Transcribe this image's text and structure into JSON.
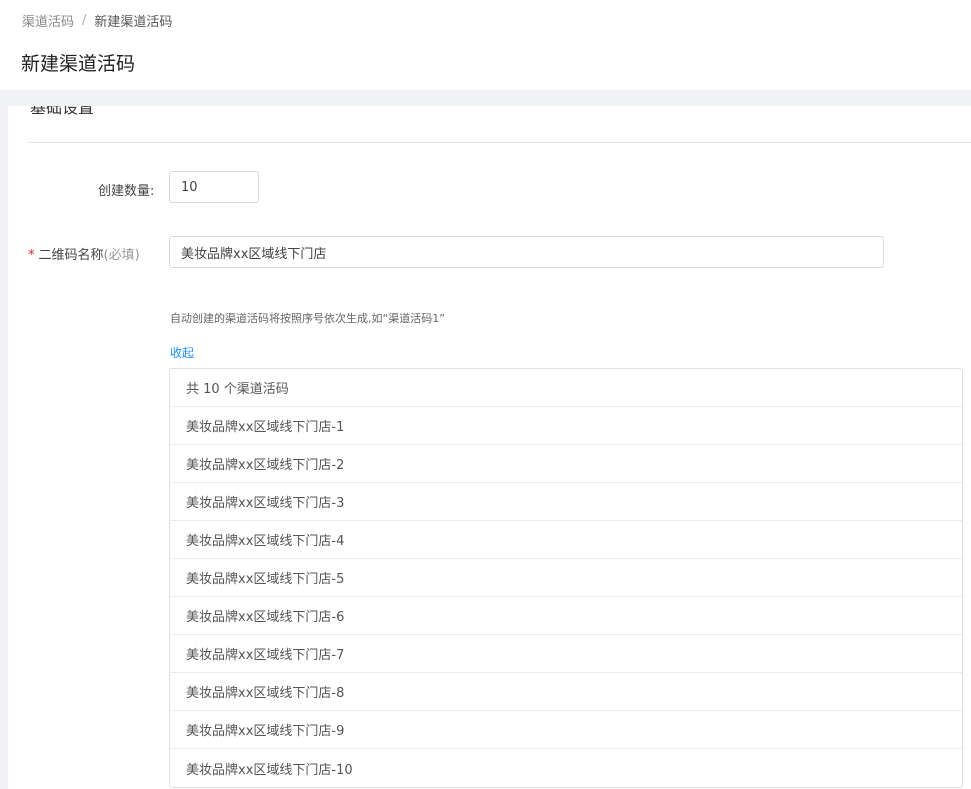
{
  "breadcrumb": {
    "parent": "渠道活码",
    "separator": "/",
    "current": "新建渠道活码"
  },
  "page_title": "新建渠道活码",
  "section": {
    "title": "基础设置"
  },
  "form": {
    "count_label": "创建数量:",
    "count_value": "10",
    "name_required_mark": "*",
    "name_label": "二维码名称",
    "name_hint": "(必填)",
    "name_value": "美妆品牌xx区域线下门店",
    "help_text": "自动创建的渠道活码将按照序号依次生成,如“渠道活码1”",
    "collapse_label": "收起"
  },
  "list": {
    "header": "共 10 个渠道活码",
    "items": [
      "美妆品牌xx区域线下门店-1",
      "美妆品牌xx区域线下门店-2",
      "美妆品牌xx区域线下门店-3",
      "美妆品牌xx区域线下门店-4",
      "美妆品牌xx区域线下门店-5",
      "美妆品牌xx区域线下门店-6",
      "美妆品牌xx区域线下门店-7",
      "美妆品牌xx区域线下门店-8",
      "美妆品牌xx区域线下门店-9",
      "美妆品牌xx区域线下门店-10"
    ]
  },
  "colors": {
    "link": "#1890ff",
    "required": "#e02020",
    "page_bg": "#f0f2f5"
  }
}
